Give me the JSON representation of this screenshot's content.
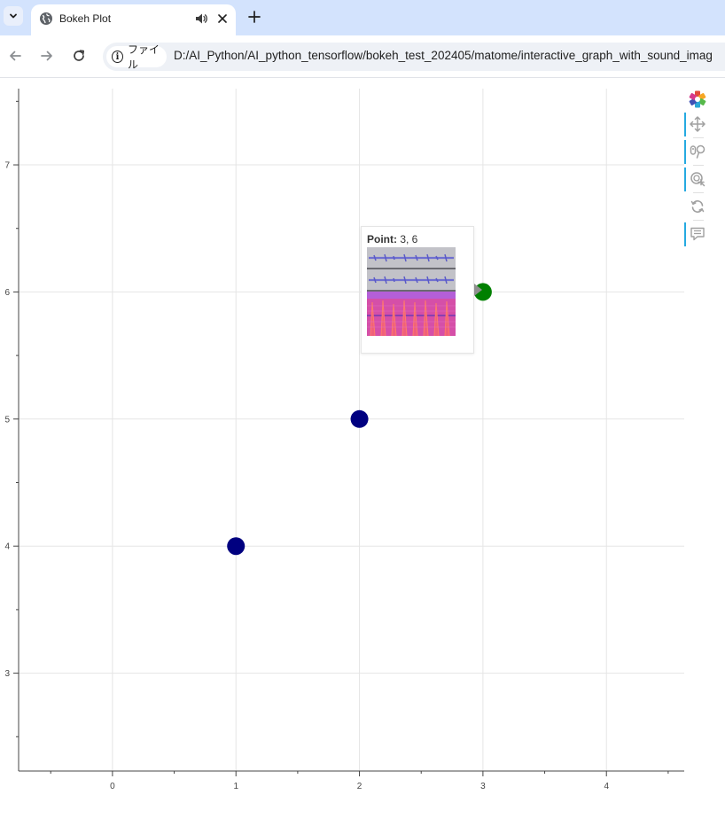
{
  "browser": {
    "tab": {
      "title": "Bokeh Plot",
      "icon": "globe-icon",
      "audio_icon": "speaker-icon"
    },
    "address": {
      "site_label": "ファイル",
      "url": "D:/AI_Python/AI_python_tensorflow/bokeh_test_202405/matome/interactive_graph_with_sound_imag"
    }
  },
  "plot": {
    "toolbar": [
      "bokeh-logo",
      "pan-tool",
      "wheel-zoom-tool",
      "box-zoom-tool",
      "reset-tool",
      "hover-tool"
    ]
  },
  "tooltip": {
    "label": "Point:",
    "value": "3, 6"
  },
  "chart_data": {
    "type": "scatter",
    "x_ticks": [
      "0",
      "1",
      "2",
      "3",
      "4"
    ],
    "y_ticks": [
      "3",
      "4",
      "5",
      "6",
      "7"
    ],
    "xlim": [
      -0.76,
      4.63
    ],
    "ylim": [
      2.23,
      7.6
    ],
    "grid": true,
    "points": [
      {
        "x": 1,
        "y": 4,
        "color": "#000080"
      },
      {
        "x": 2,
        "y": 5,
        "color": "#000080"
      },
      {
        "x": 3,
        "y": 6,
        "color": "#008000"
      }
    ]
  },
  "colors": {
    "tab_strip": "#d3e3fd",
    "accent": "#26aae1",
    "point_default": "#000080",
    "point_hover": "#008000"
  }
}
